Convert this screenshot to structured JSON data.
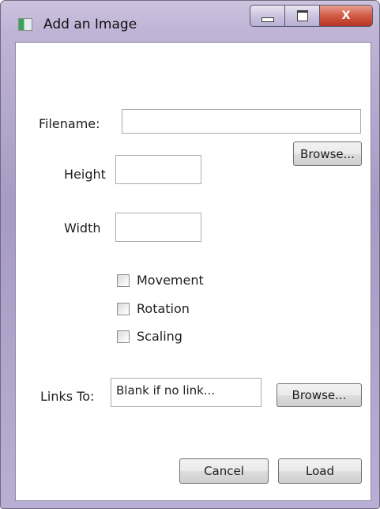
{
  "window": {
    "title": "Add an Image",
    "icon": "app-window-icon",
    "controls": {
      "minimize": "minimize-icon",
      "maximize": "maximize-icon",
      "close": "X"
    }
  },
  "form": {
    "filename_label": "Filename:",
    "filename_value": "",
    "browse_label": "Browse...",
    "height_label": "Height",
    "height_value": "",
    "width_label": "Width",
    "width_value": "",
    "checkboxes": [
      {
        "label": "Movement",
        "checked": false
      },
      {
        "label": "Rotation",
        "checked": false
      },
      {
        "label": "Scaling",
        "checked": false
      }
    ],
    "links_label": "Links To:",
    "links_placeholder": "Blank if no link...",
    "links_browse_label": "Browse...",
    "cancel_label": "Cancel",
    "load_label": "Load"
  }
}
